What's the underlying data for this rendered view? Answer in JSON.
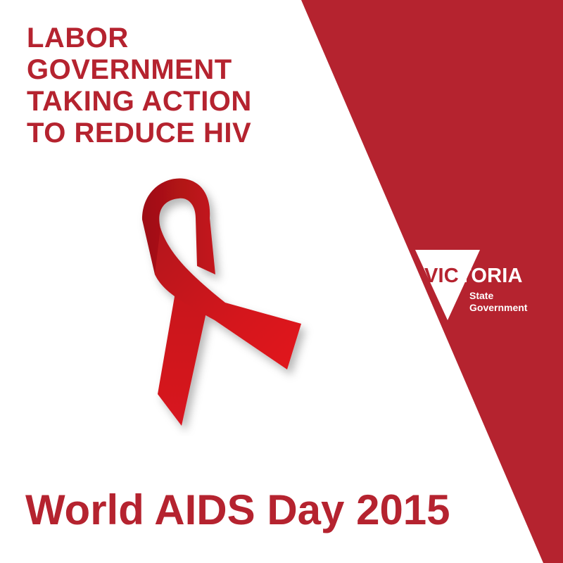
{
  "colors": {
    "brand_red": "#b5232f",
    "ribbon_red": "#d4141b",
    "background": "#ffffff",
    "logo_text": "#ffffff"
  },
  "headline": {
    "lines": [
      "LABOR",
      "GOVERNMENT",
      "TAKING ACTION",
      "TO REDUCE HIV"
    ]
  },
  "ribbon": {
    "icon": "red-ribbon-icon"
  },
  "logo": {
    "icon": "victoria-v-mark-icon",
    "word_prefix": "VIC",
    "word_rest": "TORIA",
    "sub_line1": "State",
    "sub_line2": "Government"
  },
  "footer": {
    "title": "World AIDS Day 2015"
  }
}
